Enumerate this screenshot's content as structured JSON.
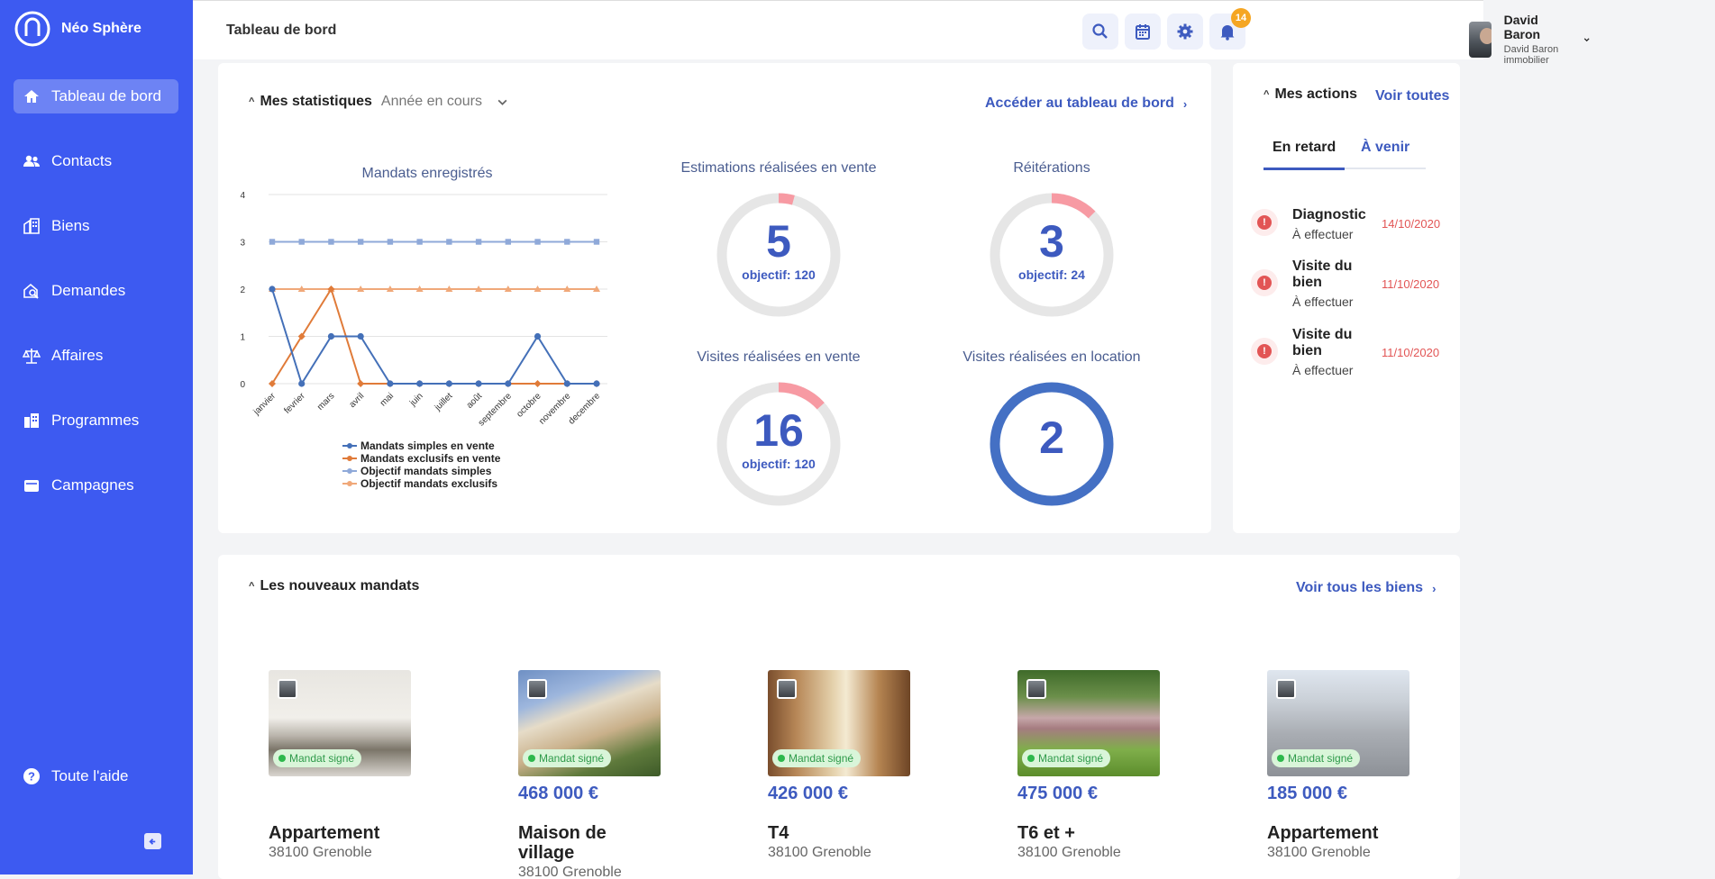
{
  "brand": {
    "name": "Néo Sphère"
  },
  "sidebar": {
    "items": [
      {
        "label": "Tableau de bord",
        "icon": "home-icon"
      },
      {
        "label": "Contacts",
        "icon": "users-icon"
      },
      {
        "label": "Biens",
        "icon": "building-icon"
      },
      {
        "label": "Demandes",
        "icon": "house-search-icon"
      },
      {
        "label": "Affaires",
        "icon": "scale-icon"
      },
      {
        "label": "Programmes",
        "icon": "buildings-icon"
      },
      {
        "label": "Campagnes",
        "icon": "mailbox-icon"
      }
    ],
    "help": "Toute l'aide"
  },
  "header": {
    "title": "Tableau de bord",
    "notifications": "14",
    "user": {
      "name": "David Baron",
      "agency": "David Baron immobilier"
    }
  },
  "stats": {
    "title": "Mes statistiques",
    "period": "Année en cours",
    "link": "Accéder au tableau de bord",
    "kpis": [
      {
        "title": "Estimations réalisées en vente",
        "value": "5",
        "objective": "objectif: 120",
        "progress": 0.042
      },
      {
        "title": "Réitérations",
        "value": "3",
        "objective": "objectif: 24",
        "progress": 0.125
      },
      {
        "title": "Visites réalisées en vente",
        "value": "16",
        "objective": "objectif: 120",
        "progress": 0.133
      },
      {
        "title": "Visites réalisées en location",
        "value": "2",
        "objective": "",
        "progress": 1
      }
    ]
  },
  "chart_data": {
    "type": "line",
    "title": "Mandats enregistrés",
    "categories": [
      "janvier",
      "fevrier",
      "mars",
      "avril",
      "mai",
      "juin",
      "juillet",
      "août",
      "septembre",
      "octobre",
      "novembre",
      "decembre"
    ],
    "ylim": [
      0,
      4
    ],
    "yticks": [
      "0",
      "1",
      "2",
      "3",
      "4"
    ],
    "grid": true,
    "legend_position": "bottom",
    "series": [
      {
        "name": "Mandats simples en vente",
        "values": [
          2,
          0,
          1,
          1,
          0,
          0,
          0,
          0,
          0,
          1,
          0,
          0
        ],
        "color": "#4470b8",
        "marker": "circle"
      },
      {
        "name": "Mandats exclusifs en vente",
        "values": [
          0,
          1,
          2,
          0,
          0,
          0,
          0,
          0,
          0,
          0,
          0,
          0
        ],
        "color": "#e07b39",
        "marker": "diamond"
      },
      {
        "name": "Objectif mandats simples",
        "values": [
          3,
          3,
          3,
          3,
          3,
          3,
          3,
          3,
          3,
          3,
          3,
          3
        ],
        "color": "#8fa9d9",
        "marker": "square"
      },
      {
        "name": "Objectif mandats exclusifs",
        "values": [
          2,
          2,
          2,
          2,
          2,
          2,
          2,
          2,
          2,
          2,
          2,
          2
        ],
        "color": "#f0a879",
        "marker": "triangle"
      }
    ]
  },
  "actions": {
    "title": "Mes actions",
    "link": "Voir toutes",
    "tabs": [
      "En retard",
      "À venir"
    ],
    "items": [
      {
        "title": "Diagnostic",
        "status": "À effectuer",
        "date": "14/10/2020"
      },
      {
        "title": "Visite du bien",
        "status": "À effectuer",
        "date": "11/10/2020"
      },
      {
        "title": "Visite du bien",
        "status": "À effectuer",
        "date": "11/10/2020"
      }
    ]
  },
  "mandats": {
    "title": "Les nouveaux mandats",
    "link": "Voir tous les biens",
    "badge": "Mandat signé",
    "properties": [
      {
        "type": "Appartement",
        "price": "",
        "city": "38100 Grenoble"
      },
      {
        "type": "Maison de village",
        "price": "468 000 €",
        "city": "38100 Grenoble"
      },
      {
        "type": "T4",
        "price": "426 000 €",
        "city": "38100 Grenoble"
      },
      {
        "type": "T6 et +",
        "price": "475 000 €",
        "city": "38100 Grenoble"
      },
      {
        "type": "Appartement",
        "price": "185 000 €",
        "city": "38100 Grenoble"
      }
    ]
  }
}
